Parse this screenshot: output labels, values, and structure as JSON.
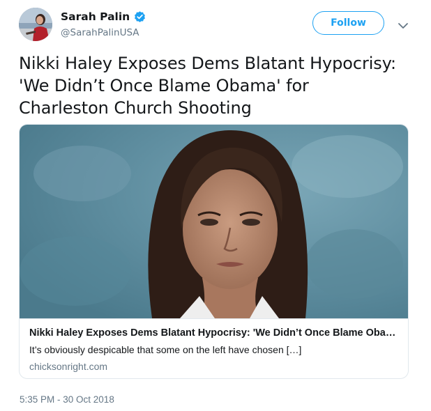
{
  "author": {
    "display_name": "Sarah Palin",
    "handle": "@SarahPalinUSA",
    "verified": true,
    "avatar_icon": "user-avatar-photo"
  },
  "actions": {
    "follow_label": "Follow",
    "more_icon": "chevron-down-icon"
  },
  "tweet": {
    "text": "Nikki Haley Exposes Dems Blatant Hypocrisy:\n'We Didn’t Once Blame Obama' for\nCharleston Church Shooting",
    "timestamp": "5:35 PM - 30 Oct 2018"
  },
  "card": {
    "image_icon": "article-photo",
    "title": "Nikki Haley Exposes Dems Blatant Hypocrisy: 'We Didn’t Once Blame Obama...",
    "description": "It’s obviously despicable that some on the left have chosen […]",
    "domain": "chicksonright.com"
  },
  "colors": {
    "accent": "#1da1f2",
    "text_primary": "#14171a",
    "text_secondary": "#657786",
    "border": "#e1e8ed",
    "image_background": "#5f8ea0"
  }
}
